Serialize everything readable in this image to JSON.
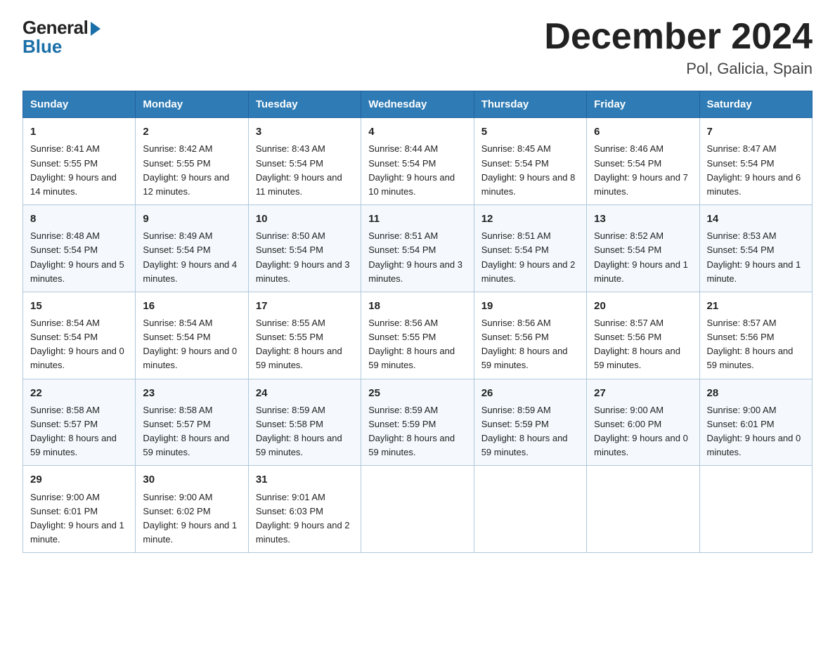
{
  "header": {
    "logo_general": "General",
    "logo_blue": "Blue",
    "month_title": "December 2024",
    "location": "Pol, Galicia, Spain"
  },
  "days_of_week": [
    "Sunday",
    "Monday",
    "Tuesday",
    "Wednesday",
    "Thursday",
    "Friday",
    "Saturday"
  ],
  "weeks": [
    [
      {
        "day": "1",
        "sunrise": "Sunrise: 8:41 AM",
        "sunset": "Sunset: 5:55 PM",
        "daylight": "Daylight: 9 hours and 14 minutes."
      },
      {
        "day": "2",
        "sunrise": "Sunrise: 8:42 AM",
        "sunset": "Sunset: 5:55 PM",
        "daylight": "Daylight: 9 hours and 12 minutes."
      },
      {
        "day": "3",
        "sunrise": "Sunrise: 8:43 AM",
        "sunset": "Sunset: 5:54 PM",
        "daylight": "Daylight: 9 hours and 11 minutes."
      },
      {
        "day": "4",
        "sunrise": "Sunrise: 8:44 AM",
        "sunset": "Sunset: 5:54 PM",
        "daylight": "Daylight: 9 hours and 10 minutes."
      },
      {
        "day": "5",
        "sunrise": "Sunrise: 8:45 AM",
        "sunset": "Sunset: 5:54 PM",
        "daylight": "Daylight: 9 hours and 8 minutes."
      },
      {
        "day": "6",
        "sunrise": "Sunrise: 8:46 AM",
        "sunset": "Sunset: 5:54 PM",
        "daylight": "Daylight: 9 hours and 7 minutes."
      },
      {
        "day": "7",
        "sunrise": "Sunrise: 8:47 AM",
        "sunset": "Sunset: 5:54 PM",
        "daylight": "Daylight: 9 hours and 6 minutes."
      }
    ],
    [
      {
        "day": "8",
        "sunrise": "Sunrise: 8:48 AM",
        "sunset": "Sunset: 5:54 PM",
        "daylight": "Daylight: 9 hours and 5 minutes."
      },
      {
        "day": "9",
        "sunrise": "Sunrise: 8:49 AM",
        "sunset": "Sunset: 5:54 PM",
        "daylight": "Daylight: 9 hours and 4 minutes."
      },
      {
        "day": "10",
        "sunrise": "Sunrise: 8:50 AM",
        "sunset": "Sunset: 5:54 PM",
        "daylight": "Daylight: 9 hours and 3 minutes."
      },
      {
        "day": "11",
        "sunrise": "Sunrise: 8:51 AM",
        "sunset": "Sunset: 5:54 PM",
        "daylight": "Daylight: 9 hours and 3 minutes."
      },
      {
        "day": "12",
        "sunrise": "Sunrise: 8:51 AM",
        "sunset": "Sunset: 5:54 PM",
        "daylight": "Daylight: 9 hours and 2 minutes."
      },
      {
        "day": "13",
        "sunrise": "Sunrise: 8:52 AM",
        "sunset": "Sunset: 5:54 PM",
        "daylight": "Daylight: 9 hours and 1 minute."
      },
      {
        "day": "14",
        "sunrise": "Sunrise: 8:53 AM",
        "sunset": "Sunset: 5:54 PM",
        "daylight": "Daylight: 9 hours and 1 minute."
      }
    ],
    [
      {
        "day": "15",
        "sunrise": "Sunrise: 8:54 AM",
        "sunset": "Sunset: 5:54 PM",
        "daylight": "Daylight: 9 hours and 0 minutes."
      },
      {
        "day": "16",
        "sunrise": "Sunrise: 8:54 AM",
        "sunset": "Sunset: 5:54 PM",
        "daylight": "Daylight: 9 hours and 0 minutes."
      },
      {
        "day": "17",
        "sunrise": "Sunrise: 8:55 AM",
        "sunset": "Sunset: 5:55 PM",
        "daylight": "Daylight: 8 hours and 59 minutes."
      },
      {
        "day": "18",
        "sunrise": "Sunrise: 8:56 AM",
        "sunset": "Sunset: 5:55 PM",
        "daylight": "Daylight: 8 hours and 59 minutes."
      },
      {
        "day": "19",
        "sunrise": "Sunrise: 8:56 AM",
        "sunset": "Sunset: 5:56 PM",
        "daylight": "Daylight: 8 hours and 59 minutes."
      },
      {
        "day": "20",
        "sunrise": "Sunrise: 8:57 AM",
        "sunset": "Sunset: 5:56 PM",
        "daylight": "Daylight: 8 hours and 59 minutes."
      },
      {
        "day": "21",
        "sunrise": "Sunrise: 8:57 AM",
        "sunset": "Sunset: 5:56 PM",
        "daylight": "Daylight: 8 hours and 59 minutes."
      }
    ],
    [
      {
        "day": "22",
        "sunrise": "Sunrise: 8:58 AM",
        "sunset": "Sunset: 5:57 PM",
        "daylight": "Daylight: 8 hours and 59 minutes."
      },
      {
        "day": "23",
        "sunrise": "Sunrise: 8:58 AM",
        "sunset": "Sunset: 5:57 PM",
        "daylight": "Daylight: 8 hours and 59 minutes."
      },
      {
        "day": "24",
        "sunrise": "Sunrise: 8:59 AM",
        "sunset": "Sunset: 5:58 PM",
        "daylight": "Daylight: 8 hours and 59 minutes."
      },
      {
        "day": "25",
        "sunrise": "Sunrise: 8:59 AM",
        "sunset": "Sunset: 5:59 PM",
        "daylight": "Daylight: 8 hours and 59 minutes."
      },
      {
        "day": "26",
        "sunrise": "Sunrise: 8:59 AM",
        "sunset": "Sunset: 5:59 PM",
        "daylight": "Daylight: 8 hours and 59 minutes."
      },
      {
        "day": "27",
        "sunrise": "Sunrise: 9:00 AM",
        "sunset": "Sunset: 6:00 PM",
        "daylight": "Daylight: 9 hours and 0 minutes."
      },
      {
        "day": "28",
        "sunrise": "Sunrise: 9:00 AM",
        "sunset": "Sunset: 6:01 PM",
        "daylight": "Daylight: 9 hours and 0 minutes."
      }
    ],
    [
      {
        "day": "29",
        "sunrise": "Sunrise: 9:00 AM",
        "sunset": "Sunset: 6:01 PM",
        "daylight": "Daylight: 9 hours and 1 minute."
      },
      {
        "day": "30",
        "sunrise": "Sunrise: 9:00 AM",
        "sunset": "Sunset: 6:02 PM",
        "daylight": "Daylight: 9 hours and 1 minute."
      },
      {
        "day": "31",
        "sunrise": "Sunrise: 9:01 AM",
        "sunset": "Sunset: 6:03 PM",
        "daylight": "Daylight: 9 hours and 2 minutes."
      },
      null,
      null,
      null,
      null
    ]
  ]
}
